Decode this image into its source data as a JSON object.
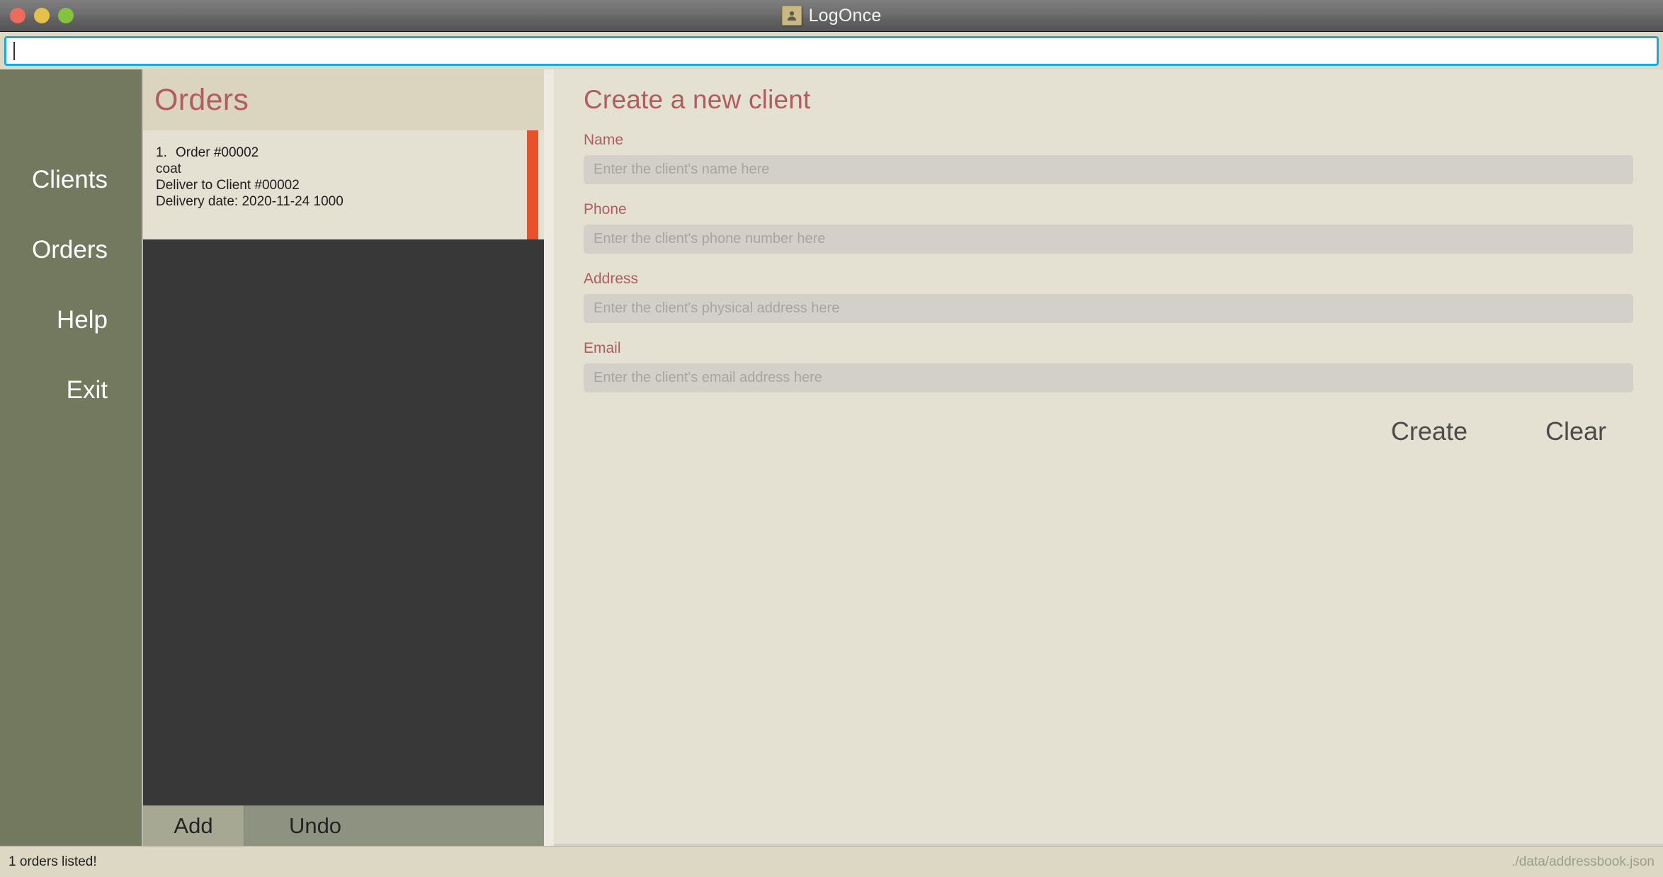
{
  "window": {
    "title": "LogOnce",
    "app_icon": "contact-person-icon",
    "traffic_lights": [
      {
        "name": "close",
        "color": "#eb6b5c"
      },
      {
        "name": "minimize",
        "color": "#e6c04c"
      },
      {
        "name": "zoom",
        "color": "#84c33c"
      }
    ]
  },
  "command_bar": {
    "value": "",
    "placeholder": "",
    "focused": true,
    "focus_color": "#18a9dd"
  },
  "sidebar": {
    "background": "#73795f",
    "items": [
      {
        "label": "Clients"
      },
      {
        "label": "Orders"
      },
      {
        "label": "Help"
      },
      {
        "label": "Exit"
      }
    ]
  },
  "orders_panel": {
    "title": "Orders",
    "title_color": "#b05c60",
    "scrollbar_color": "#e8512a",
    "items": [
      {
        "index": "1.",
        "title": "Order #00002",
        "product": "coat",
        "deliver_to": "Deliver to Client #00002",
        "delivery_date": "Delivery date: 2020-11-24 1000"
      }
    ],
    "actions": [
      {
        "label": "Add",
        "active": true
      },
      {
        "label": "Undo",
        "active": false
      }
    ]
  },
  "client_form": {
    "title": "Create a new client",
    "title_color": "#b05c60",
    "fields": [
      {
        "label": "Name",
        "value": "",
        "placeholder": "Enter the client's name here"
      },
      {
        "label": "Phone",
        "value": "",
        "placeholder": "Enter the client's phone number here"
      },
      {
        "label": "Address",
        "value": "",
        "placeholder": "Enter the client's physical address here"
      },
      {
        "label": "Email",
        "value": "",
        "placeholder": "Enter the client's email address here"
      }
    ],
    "buttons": [
      {
        "label": "Create"
      },
      {
        "label": "Clear"
      }
    ]
  },
  "statusbar": {
    "message": "1 orders listed!",
    "file_path": "./data/addressbook.json"
  }
}
